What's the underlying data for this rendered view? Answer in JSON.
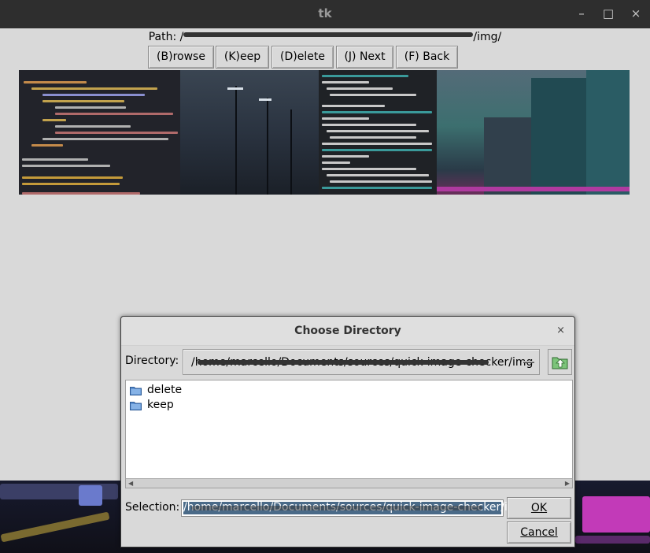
{
  "window": {
    "title": "tk",
    "minimize": "–",
    "maximize": "□",
    "close": "×"
  },
  "path": {
    "label": "Path:",
    "value_start": "/",
    "value_end": "/img/"
  },
  "toolbar": {
    "browse": "(B)rowse",
    "keep": "(K)eep",
    "delete": "(D)elete",
    "next": "(J) Next",
    "back": "(F) Back"
  },
  "preview": {
    "code_lines": [
      "def FittableImage(img):",
      "if (img.width > 500) or (img.height > 500):",
      "print(img.width, 'x', img.height)",
      "if img.width > img.height:",
      "ratio = 500 / img.width",
      "newsize = (500, int(img.height * ratio))",
      "else:",
      "ratio = 500 / img.height",
      "newsize = (int(img.width * ratio), 500)",
      "img = img.resize(newsize, Image.ANTIALIAS)",
      "return img",
      "topFrame = Frame(frame)",
      "topFrame.grid(column=0, row=0)",
      "bottomFrame = Frame(frame, bg='black')",
      "bottomFrame.grid(column=0, row=1)"
    ],
    "term_lines": [
      "$ python hello.py",
      "File \"hello.py\", line 51",
      "if img.width > img.height:",
      "SyntaxError: invalid syntax",
      "quick-image-checker",
      "$ python hello.py",
      "Traceback (most recent call last):",
      "File \"hello.py\", line 50, in <module>",
      "iprint(img.width, 'x', img.height)",
      "NameError: name 'iprint' is not defined",
      "quick-image-checker",
      "$ python hello.py",
      "327 x 865",
      "Traceback (most recent call last):",
      "File \"hello.py\", line 57, in <module>",
      "img = img.resize(newsize, Image.ANTIALIAS)",
      "NameError: name 'newsize' is not defined",
      "quick-image-checker",
      "$ python hello.py"
    ]
  },
  "dialog": {
    "title": "Choose Directory",
    "close": "×",
    "directory_label": "Directory:",
    "directory_value": "/home/marcello/Documents/sources/quick-image-checker/img",
    "folders": [
      "delete",
      "keep"
    ],
    "selection_label": "Selection:",
    "selection_value": "/home/marcello/Documents/sources/quick-image-checker/img",
    "ok": "OK",
    "cancel": "Cancel"
  },
  "colors": {
    "titlebar": "#2e2e2e",
    "window_bg": "#d9d9d9",
    "selection": "#4a6a88",
    "folder": "#5b8fcf"
  },
  "icons": {
    "up_folder": "folder-up-icon",
    "folder": "folder-icon"
  }
}
